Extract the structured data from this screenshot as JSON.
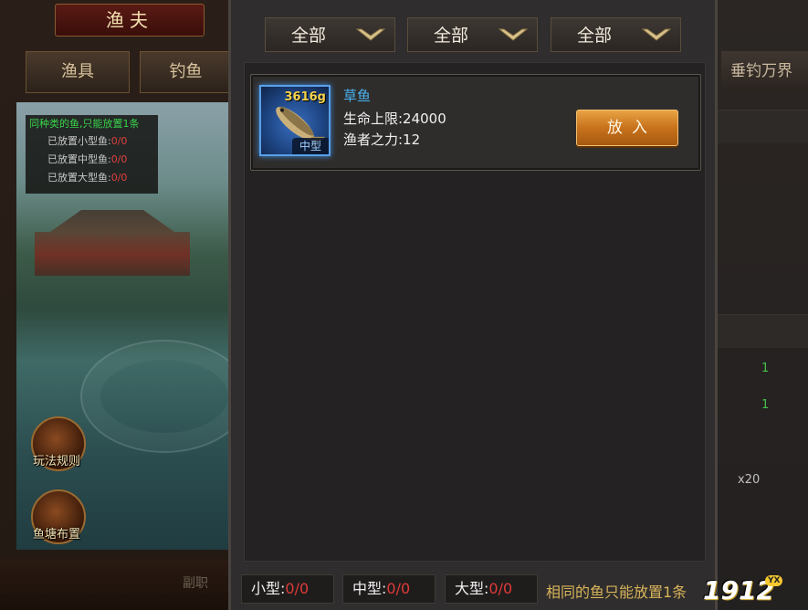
{
  "background": {
    "left_panel": {
      "title": "渔夫",
      "tabs": [
        "渔具",
        "钓鱼"
      ],
      "info_header": "同种类的鱼,只能放置1条",
      "info_rows": [
        {
          "label": "已放置小型鱼:",
          "value": "0/0"
        },
        {
          "label": "已放置中型鱼:",
          "value": "0/0"
        },
        {
          "label": "已放置大型鱼:",
          "value": "0/0"
        }
      ],
      "round_buttons": [
        {
          "label": "玩法规则"
        },
        {
          "label": "鱼塘布置"
        }
      ],
      "bottom_label": "副职"
    },
    "right_panel": {
      "tab": "垂钓万界",
      "green_values": [
        "1",
        "1"
      ],
      "count_text": "x20"
    }
  },
  "dialog": {
    "filters": [
      {
        "label": "全部"
      },
      {
        "label": "全部"
      },
      {
        "label": "全部"
      }
    ],
    "fish_items": [
      {
        "name": "草鱼",
        "weight": "3616g",
        "size": "中型",
        "stats": [
          {
            "text": "生命上限:24000"
          },
          {
            "text": "渔者之力:12"
          }
        ],
        "action_label": "放入"
      }
    ],
    "counters": [
      {
        "label": "小型:",
        "value": "0/0"
      },
      {
        "label": "中型:",
        "value": "0/0"
      },
      {
        "label": "大型:",
        "value": "0/0"
      }
    ],
    "notice": "相同的鱼只能放置1条",
    "logo_text": "1912",
    "logo_sub": "YX",
    "colors": {
      "fish_name": "#48b4f0",
      "weight": "#f6d24a",
      "counter_value": "#e03a3a",
      "notice": "#d8b45a",
      "action_button": "#c8721c"
    }
  }
}
